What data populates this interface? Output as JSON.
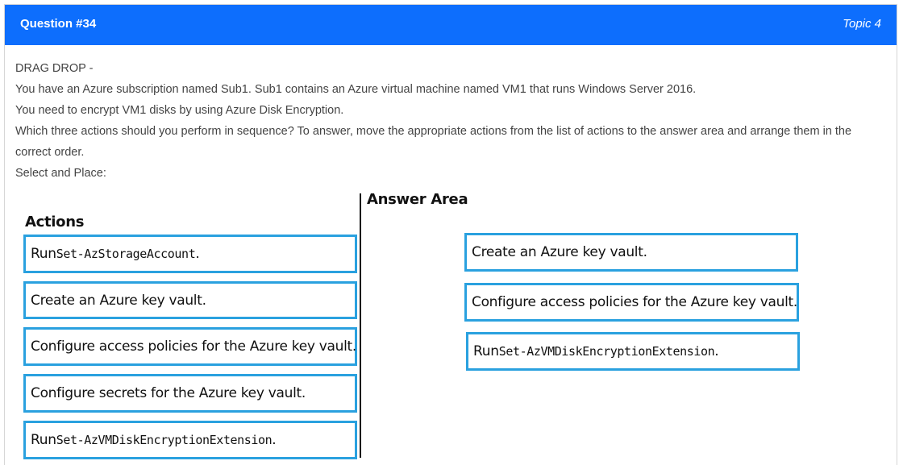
{
  "header": {
    "question": "Question #34",
    "topic": "Topic 4"
  },
  "body": {
    "lines": [
      "DRAG DROP -",
      "You have an Azure subscription named Sub1. Sub1 contains an Azure virtual machine named VM1 that runs Windows Server 2016.",
      "You need to encrypt VM1 disks by using Azure Disk Encryption.",
      "Which three actions should you perform in sequence? To answer, move the appropriate actions from the list of actions to the answer area and arrange them in the correct order.",
      "Select and Place:"
    ]
  },
  "exhibit": {
    "actions_heading": "Actions",
    "answer_heading": "Answer Area",
    "actions": [
      {
        "prefix": "Run ",
        "code": "Set-AzStorageAccount",
        "suffix": "."
      },
      {
        "prefix": "Create an Azure key vault.",
        "code": "",
        "suffix": ""
      },
      {
        "prefix": "Configure access policies for the Azure key vault.",
        "code": "",
        "suffix": ""
      },
      {
        "prefix": "Configure secrets for the Azure key vault.",
        "code": "",
        "suffix": ""
      },
      {
        "prefix": "Run ",
        "code": "Set-AzVMDiskEncryptionExtension",
        "suffix": "."
      }
    ],
    "answers": [
      {
        "prefix": "Create an Azure key vault.",
        "code": "",
        "suffix": ""
      },
      {
        "prefix": "Configure access policies for the Azure key vault.",
        "code": "",
        "suffix": ""
      },
      {
        "prefix": "Run ",
        "code": "Set-AzVMDiskEncryptionExtension",
        "suffix": "."
      }
    ],
    "accent_color": "#2aa1df"
  },
  "colors": {
    "header_bg": "#0d6efd",
    "body_text": "#444444"
  }
}
